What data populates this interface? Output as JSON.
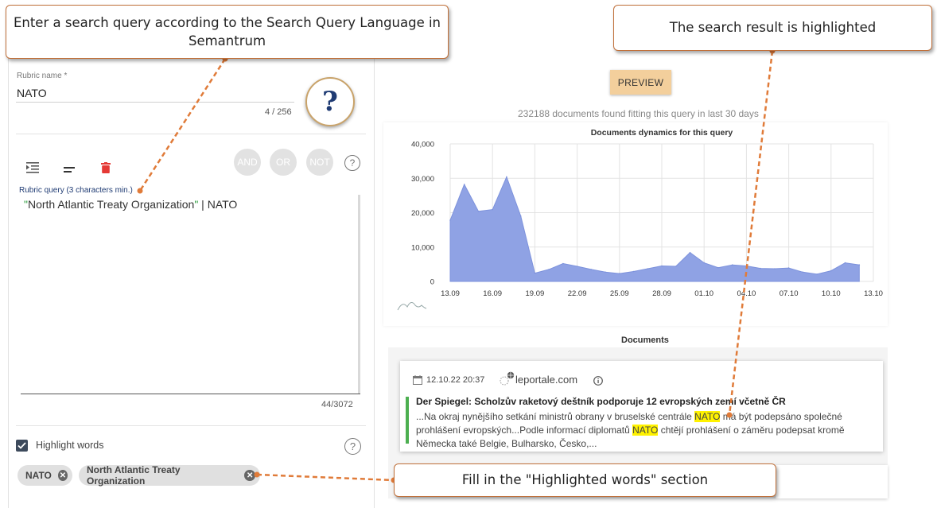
{
  "callouts": {
    "query": "Enter a search query according to the Search Query Language in Semantrum",
    "result": "The search result is highlighted",
    "words": "Fill in the \"Highlighted words\" section"
  },
  "rubric": {
    "name_label": "Rubric name *",
    "name_value": "NATO",
    "name_counter": "4 / 256",
    "query_label": "Rubric query (3 characters min.)",
    "query_open_quote": "\"",
    "query_phrase": "North Atlantic Treaty Organization",
    "query_close_quote": "\"",
    "query_rest": " | NATO",
    "query_counter": "44/3072",
    "logic_buttons": [
      "AND",
      "OR",
      "NOT"
    ],
    "help_glyph": "?",
    "badge_glyph": "?"
  },
  "highlight": {
    "label": "Highlight words",
    "checked": true,
    "chips": [
      "NATO",
      "North Atlantic Treaty Organization"
    ],
    "help_glyph": "?"
  },
  "preview": {
    "button": "PREVIEW",
    "found_text": "232188 documents found fitting this query in last 30 days"
  },
  "chart_data": {
    "type": "area",
    "title": "Documents dynamics for this query",
    "color": "#8fa2e4",
    "ylim": [
      0,
      40000
    ],
    "yticks": [
      "0",
      "10,000",
      "20,000",
      "30,000",
      "40,000"
    ],
    "xticks": [
      "13.09",
      "16.09",
      "19.09",
      "22.09",
      "25.09",
      "28.09",
      "01.10",
      "04.10",
      "07.10",
      "10.10",
      "13.10"
    ],
    "x_index": [
      0,
      1,
      2,
      3,
      4,
      5,
      6,
      7,
      8,
      9,
      10,
      11,
      12,
      13,
      14,
      15,
      16,
      17,
      18,
      19,
      20,
      21,
      22,
      23,
      24,
      25,
      26,
      27,
      28,
      29,
      30
    ],
    "values": [
      17800,
      28200,
      20400,
      20900,
      30400,
      19000,
      2400,
      3500,
      5200,
      4400,
      3500,
      2700,
      2300,
      2900,
      3700,
      4500,
      4400,
      8400,
      5400,
      4000,
      4800,
      4500,
      3800,
      3700,
      3900,
      2700,
      2100,
      3100,
      5400,
      4800
    ]
  },
  "documents": {
    "header": "Documents",
    "items": [
      {
        "date": "12.10.22 20:37",
        "source": "leportale.com",
        "title": "Der Spiegel: Scholzův raketový deštník podporuje 12 evropských zemí včetně ČR",
        "line1_before": "...Na okraj nynějšího setkání ministrů obrany v bruselské centrále ",
        "line1_hl": "NATO",
        "line1_after": " má být podepsáno společné",
        "line2_before": "prohlášení evropských...Podle informací diplomatů ",
        "line2_hl": "NATO",
        "line2_after": " chtějí prohlášení o záměru podepsat kromě",
        "line3": "Německa také Belgie, Bulharsko, Česko,..."
      }
    ]
  }
}
